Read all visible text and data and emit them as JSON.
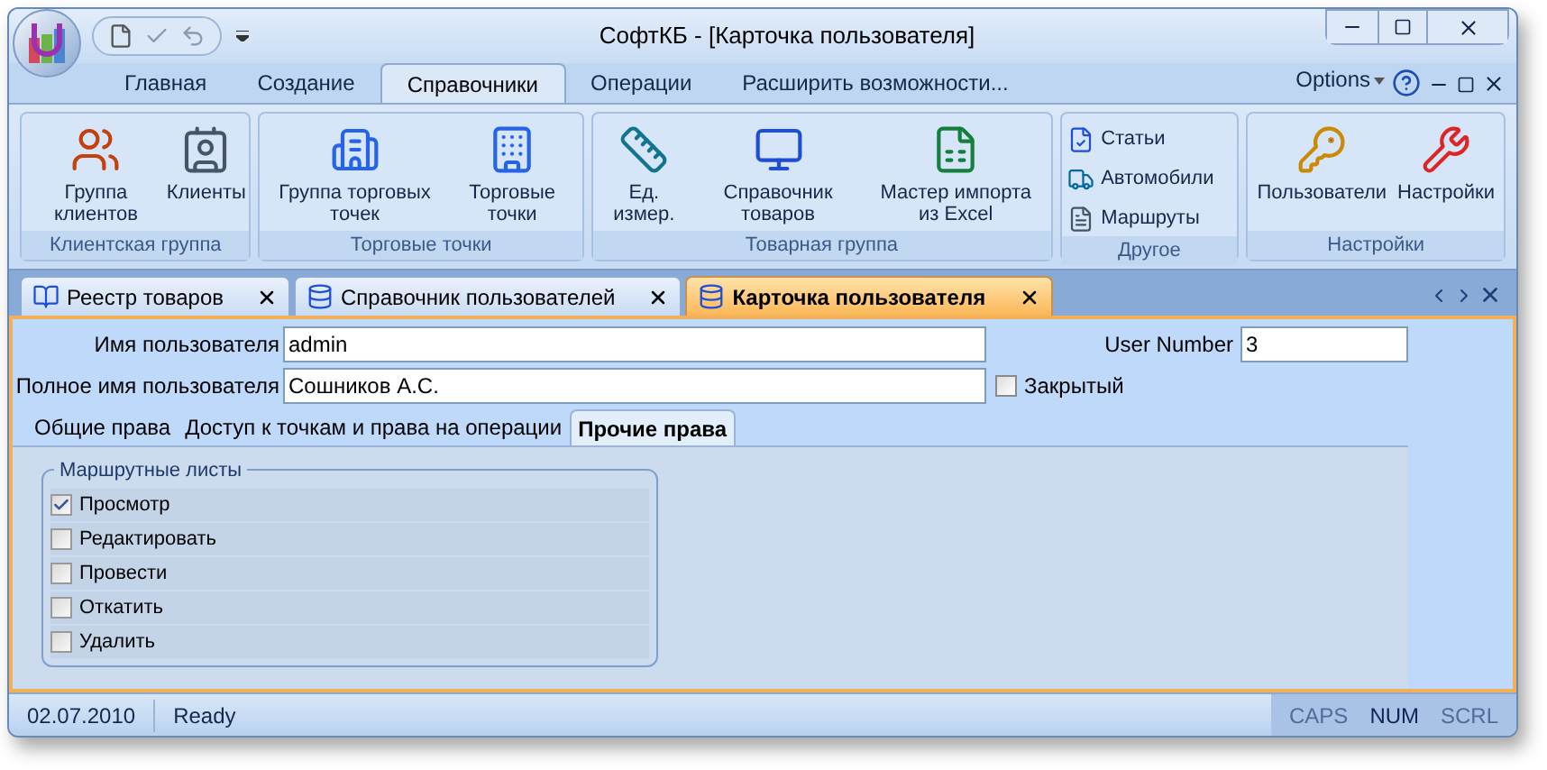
{
  "window": {
    "title": "СофтКБ - [Карточка пользователя]"
  },
  "ribbon_tabs": [
    {
      "label": "Главная",
      "selected": false
    },
    {
      "label": "Создание",
      "selected": false
    },
    {
      "label": "Справочники",
      "selected": true
    },
    {
      "label": "Операции",
      "selected": false
    },
    {
      "label": "Расширить возможности...",
      "selected": false
    }
  ],
  "options_label": "Options",
  "ribbon_groups": [
    {
      "title": "Клиентская группа",
      "buttons": [
        {
          "kind": "large",
          "label": "Группа клиентов"
        },
        {
          "kind": "large",
          "label": "Клиенты"
        }
      ]
    },
    {
      "title": "Торговые точки",
      "buttons": [
        {
          "kind": "large",
          "label": "Группа торговых точек"
        },
        {
          "kind": "large",
          "label": "Торговые точки"
        }
      ]
    },
    {
      "title": "Товарная группа",
      "buttons": [
        {
          "kind": "large",
          "label": "Ед. измер."
        },
        {
          "kind": "large",
          "label": "Справочник товаров"
        },
        {
          "kind": "large",
          "label": "Мастер импорта из Excel"
        }
      ]
    },
    {
      "title": "Другое",
      "buttons": [
        {
          "kind": "small",
          "label": "Статьи"
        },
        {
          "kind": "small",
          "label": "Автомобили"
        },
        {
          "kind": "small",
          "label": "Маршруты"
        }
      ]
    },
    {
      "title": "Настройки",
      "buttons": [
        {
          "kind": "large",
          "label": "Пользователи"
        },
        {
          "kind": "large",
          "label": "Настройки"
        }
      ]
    }
  ],
  "document_tabs": [
    {
      "label": "Реестр товаров",
      "selected": false
    },
    {
      "label": "Справочник пользователей",
      "selected": false
    },
    {
      "label": "Карточка пользователя",
      "selected": true
    }
  ],
  "form": {
    "username_label": "Имя пользователя",
    "username": "admin",
    "user_number_label": "User Number",
    "user_number": "3",
    "full_name_label": "Полное имя пользователя",
    "full_name": "Сошников А.С.",
    "closed": {
      "label": "Закрытый",
      "checked": false
    }
  },
  "form_tabs": [
    {
      "label": "Общие права",
      "selected": false
    },
    {
      "label": "Доступ к точкам и права на операции",
      "selected": false
    },
    {
      "label": "Прочие права",
      "selected": true
    }
  ],
  "route_sheets": {
    "title": "Маршрутные листы",
    "items": [
      {
        "label": "Просмотр",
        "checked": true
      },
      {
        "label": "Редактировать",
        "checked": false
      },
      {
        "label": "Провести",
        "checked": false
      },
      {
        "label": "Откатить",
        "checked": false
      },
      {
        "label": "Удалить",
        "checked": false
      }
    ]
  },
  "status_bar": {
    "date": "02.07.2010",
    "message": "Ready",
    "indicators": [
      {
        "label": "CAPS",
        "on": false
      },
      {
        "label": "NUM",
        "on": true
      },
      {
        "label": "SCRL",
        "on": false
      }
    ]
  }
}
